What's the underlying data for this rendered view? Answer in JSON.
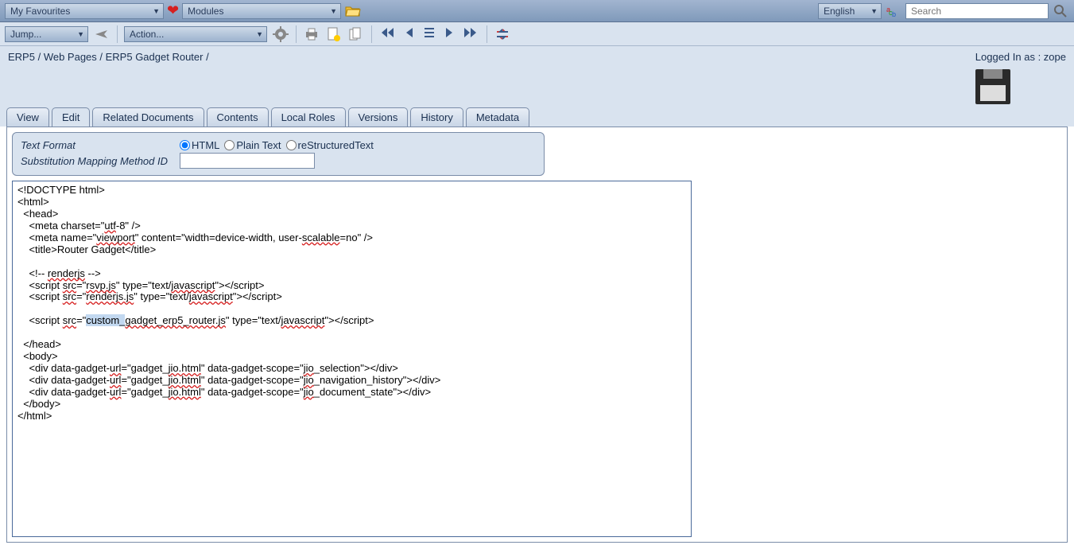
{
  "topbar": {
    "favourites": "My Favourites",
    "modules": "Modules",
    "language": "English",
    "search_placeholder": "Search"
  },
  "toolbar": {
    "jump": "Jump...",
    "action": "Action..."
  },
  "breadcrumb": {
    "root": "ERP5",
    "mid": "Web Pages",
    "leaf": "ERP5 Gadget Router",
    "sep": " / "
  },
  "login": {
    "label": "Logged In as : ",
    "user": "zope"
  },
  "tabs": {
    "view": "View",
    "edit": "Edit",
    "related": "Related Documents",
    "contents": "Contents",
    "localroles": "Local Roles",
    "versions": "Versions",
    "history": "History",
    "metadata": "Metadata"
  },
  "meta": {
    "text_format_label": "Text Format",
    "substitution_label": "Substitution Mapping Method ID",
    "radio_html": "HTML",
    "radio_plain": "Plain Text",
    "radio_rst": "reStructuredText"
  },
  "editor": {
    "l1": "<!DOCTYPE html>",
    "l2": "<html>",
    "l3": "  <head>",
    "l4a": "    <meta charset=\"",
    "l4b": "utf",
    "l4c": "-8\" />",
    "l5a": "    <meta name=\"",
    "l5b": "viewport",
    "l5c": "\" content=\"width=device-width, user-",
    "l5d": "scalable",
    "l5e": "=no\" />",
    "l6": "    <title>Router Gadget</title>",
    "l7": "",
    "l8a": "    <!-- ",
    "l8b": "renderjs",
    "l8c": " -->",
    "l9a": "    <script ",
    "l9b": "src",
    "l9c": "=\"",
    "l9d": "rsvp.js",
    "l9e": "\" type=\"text/",
    "l9f": "javascript",
    "l9g": "\"></script>",
    "l10a": "    <script ",
    "l10b": "src",
    "l10c": "=\"",
    "l10d": "renderjs.js",
    "l10e": "\" type=\"text/",
    "l10f": "javascript",
    "l10g": "\"></script>",
    "l11": "",
    "l12a": "    <script ",
    "l12b": "src",
    "l12c": "=\"",
    "l12sel": "custom_",
    "l12d": "gadget_erp5_router.js",
    "l12e": "\" type=\"text/",
    "l12f": "javascript",
    "l12g": "\"></script>",
    "l13": "",
    "l14": "  </head>",
    "l15": "  <body>",
    "l16a": "    <div data-gadget-",
    "l16b": "url",
    "l16c": "=\"gadget_",
    "l16d": "jio.html",
    "l16e": "\" data-gadget-scope=\"",
    "l16f": "jio",
    "l16g": "_selection\"></div>",
    "l17a": "    <div data-gadget-",
    "l17b": "url",
    "l17c": "=\"gadget_",
    "l17d": "jio.html",
    "l17e": "\" data-gadget-scope=\"",
    "l17f": "jio",
    "l17g": "_navigation_history\"></div>",
    "l18a": "    <div data-gadget-",
    "l18b": "url",
    "l18c": "=\"gadget_",
    "l18d": "jio.html",
    "l18e": "\" data-gadget-scope=\"",
    "l18f": "jio",
    "l18g": "_document_state\"></div>",
    "l19": "  </body>",
    "l20": "</html>"
  }
}
